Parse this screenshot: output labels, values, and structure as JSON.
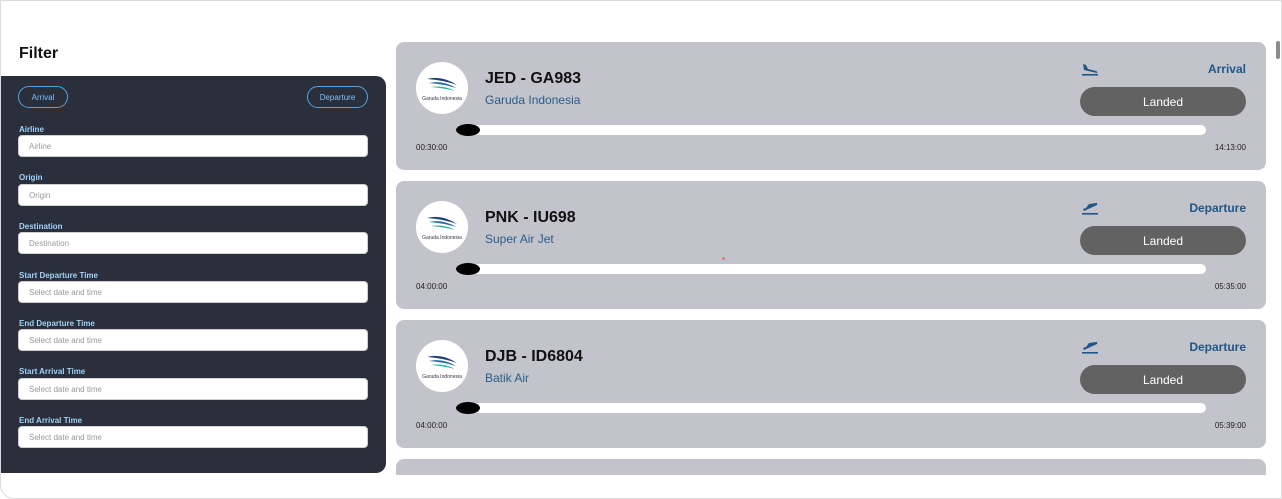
{
  "filter": {
    "title": "Filter",
    "type_buttons": {
      "arrival": "Arrival",
      "departure": "Departure"
    },
    "fields": [
      {
        "label": "Airline",
        "placeholder": "Airline"
      },
      {
        "label": "Origin",
        "placeholder": "Origin"
      },
      {
        "label": "Destination",
        "placeholder": "Destination"
      },
      {
        "label": "Start Departure Time",
        "placeholder": "Select date and time"
      },
      {
        "label": "End Departure Time",
        "placeholder": "Select date and time"
      },
      {
        "label": "Start Arrival Time",
        "placeholder": "Select date and time"
      },
      {
        "label": "End Arrival Time",
        "placeholder": "Select date and time"
      }
    ]
  },
  "flights": [
    {
      "route": "JED - GA983",
      "airline": "Garuda Indonesia",
      "logo_text": "Garuda Indonesia",
      "type": "Arrival",
      "type_icon": "plane-landing-icon",
      "status": "Landed",
      "progress": 0,
      "time_start": "00:30:00",
      "time_end": "14:13:00"
    },
    {
      "route": "PNK - IU698",
      "airline": "Super Air Jet",
      "logo_text": "Garuda Indonesia",
      "type": "Departure",
      "type_icon": "plane-takeoff-icon",
      "status": "Landed",
      "progress": 0,
      "time_start": "04:00:00",
      "time_end": "05:35:00"
    },
    {
      "route": "DJB - ID6804",
      "airline": "Batik Air",
      "logo_text": "Garuda Indonesia",
      "type": "Departure",
      "type_icon": "plane-takeoff-icon",
      "status": "Landed",
      "progress": 0,
      "time_start": "04:00:00",
      "time_end": "05:39:00"
    }
  ],
  "colors": {
    "panel_bg": "#2b2e3b",
    "card_bg": "#c3c3cb",
    "status_bg": "#626262",
    "accent": "#1f5788",
    "pill_border": "#4da3e6"
  }
}
